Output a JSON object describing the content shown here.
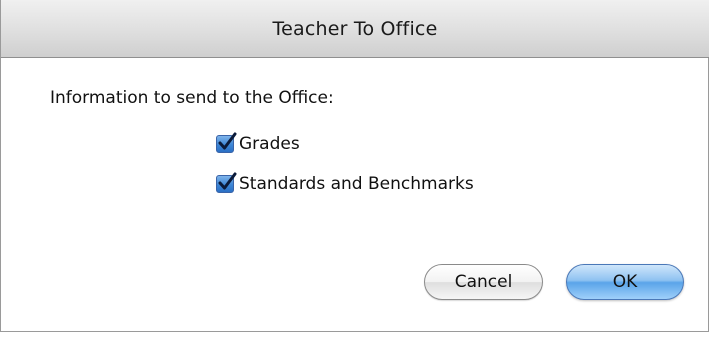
{
  "dialog": {
    "title": "Teacher To Office",
    "prompt": "Information to send to the Office:",
    "options": [
      {
        "label": "Grades",
        "checked": true
      },
      {
        "label": "Standards and Benchmarks",
        "checked": true
      }
    ],
    "buttons": {
      "cancel_label": "Cancel",
      "ok_label": "OK"
    }
  },
  "colors": {
    "accent": "#3d86d6",
    "default_button": "#5aa4e9"
  },
  "icons": {
    "checkbox": "checkmark-icon"
  }
}
